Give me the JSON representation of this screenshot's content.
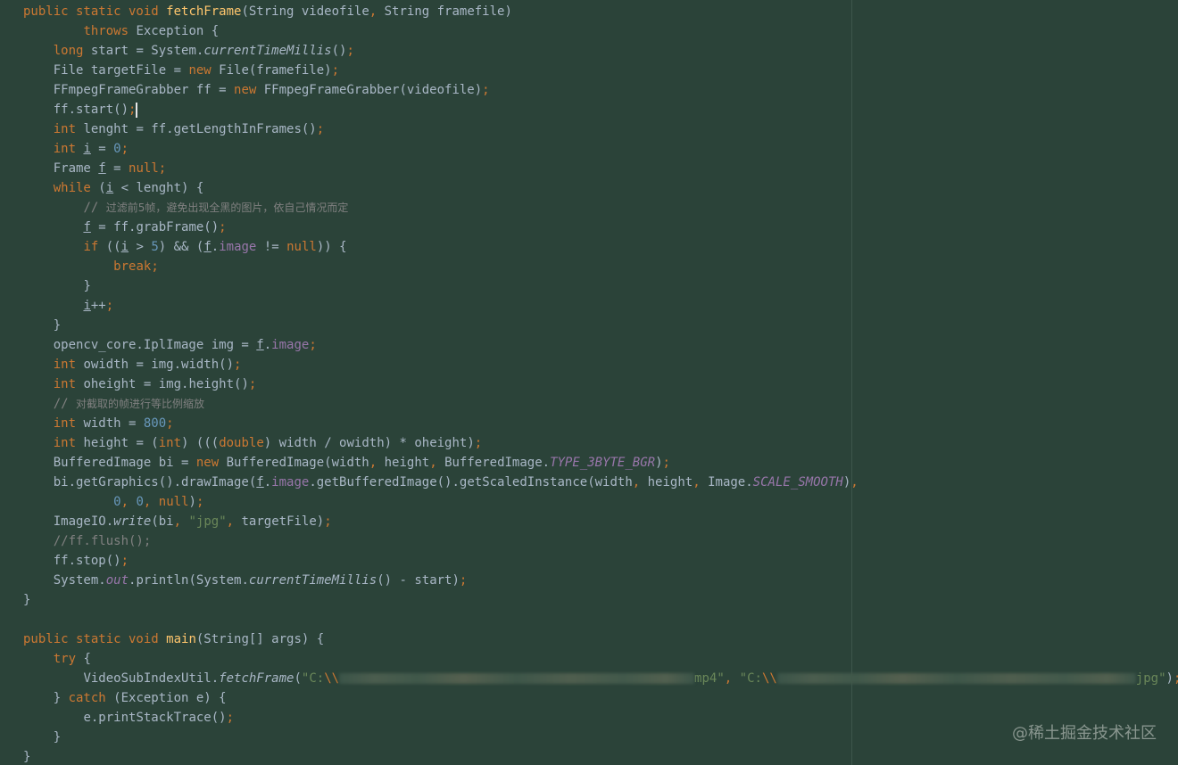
{
  "watermark": "@稀土掘金技术社区",
  "code": {
    "l1_kw": "public static void ",
    "l1_fn": "fetchFrame",
    "l1_a": "(String videofile",
    "l1_c": ", ",
    "l1_b": "String framefile)",
    "l2_kw": "throws ",
    "l2_t": "Exception {",
    "l3_kw": "long ",
    "l3_a": "start = System.",
    "l3_sm": "currentTimeMillis",
    "l3_b": "()",
    "l4_a": "File targetFile = ",
    "l4_kw": "new ",
    "l4_b": "File(framefile)",
    "l5_a": "FFmpegFrameGrabber ff = ",
    "l5_kw": "new ",
    "l5_b": "FFmpegFrameGrabber(videofile)",
    "l6_a": "ff.start()",
    "l7_kw": "int ",
    "l7_a": "lenght = ff.getLengthInFrames()",
    "l8_kw": "int ",
    "l8_v": "i",
    "l8_a": " = ",
    "l8_n": "0",
    "l9_a": "Frame ",
    "l9_v": "f",
    "l9_b": " = ",
    "l9_kw": "null",
    "l10_kw": "while ",
    "l10_a": "(",
    "l10_v": "i",
    "l10_b": " < lenght) {",
    "l11_c": "// ",
    "l11_zh": "过滤前5帧，避免出现全黑的图片，依自己情况而定",
    "l12_v": "f",
    "l12_a": " = ff.grabFrame()",
    "l13_kw": "if ",
    "l13_a": "((",
    "l13_v": "i",
    "l13_b": " > ",
    "l13_n": "5",
    "l13_c": ") && (",
    "l13_v2": "f",
    "l13_d": ".",
    "l13_f": "image",
    "l13_e": " != ",
    "l13_kw2": "null",
    "l13_g": ")) {",
    "l14_kw": "break",
    "l15_a": "}",
    "l16_v": "i",
    "l16_a": "++",
    "l17_a": "}",
    "l18_a": "opencv_core.IplImage img = ",
    "l18_v": "f",
    "l18_b": ".",
    "l18_f": "image",
    "l19_kw": "int ",
    "l19_a": "owidth = img.width()",
    "l20_kw": "int ",
    "l20_a": "oheight = img.height()",
    "l21_c": "// ",
    "l21_zh": "对截取的帧进行等比例缩放",
    "l22_kw": "int ",
    "l22_a": "width = ",
    "l22_n": "800",
    "l23_kw": "int ",
    "l23_a": "height = (",
    "l23_kw2": "int",
    "l23_b": ") (((",
    "l23_kw3": "double",
    "l23_c": ") width / owidth) * oheight)",
    "l24_a": "BufferedImage bi = ",
    "l24_kw": "new ",
    "l24_b": "BufferedImage(width",
    "l24_c": " height",
    "l24_d": " BufferedImage.",
    "l24_sf": "TYPE_3BYTE_BGR",
    "l24_e": ")",
    "l25_a": "bi.getGraphics().drawImage(",
    "l25_v": "f",
    "l25_b": ".",
    "l25_f": "image",
    "l25_c": ".getBufferedImage().getScaledInstance(width",
    "l25_d": " height",
    "l25_e": " Image.",
    "l25_sf": "SCALE_SMOOTH",
    "l25_g": ")",
    "l26_n1": "0",
    "l26_n2": "0",
    "l26_kw": "null",
    "l26_a": ")",
    "l27_a": "ImageIO.",
    "l27_sm": "write",
    "l27_b": "(bi",
    "l27_s": "\"jpg\"",
    "l27_c": " targetFile)",
    "l28_c": "//ff.flush();",
    "l29_a": "ff.stop()",
    "l30_a": "System.",
    "l30_sf": "out",
    "l30_b": ".println(System.",
    "l30_sm": "currentTimeMillis",
    "l30_c": "() - start)",
    "l31_a": "}",
    "l33_kw": "public static void ",
    "l33_fn": "main",
    "l33_a": "(String[] args) {",
    "l34_kw": "try ",
    "l34_a": "{",
    "l35_a": "VideoSubIndexUtil.",
    "l35_sm": "fetchFrame",
    "l35_b": "(",
    "l35_s1": "\"C:",
    "l35_e1": "\\\\",
    "l35_s2": "mp4\"",
    "l35_s3": "\"C:",
    "l35_e2": "\\\\",
    "l35_s4": "jpg\"",
    "l35_c": ")",
    "l36_a": "} ",
    "l36_kw": "catch ",
    "l36_b": "(Exception e) {",
    "l37_a": "e.printStackTrace()",
    "l38_a": "}",
    "l39_a": "}",
    "semi": ";",
    "comma": ","
  }
}
